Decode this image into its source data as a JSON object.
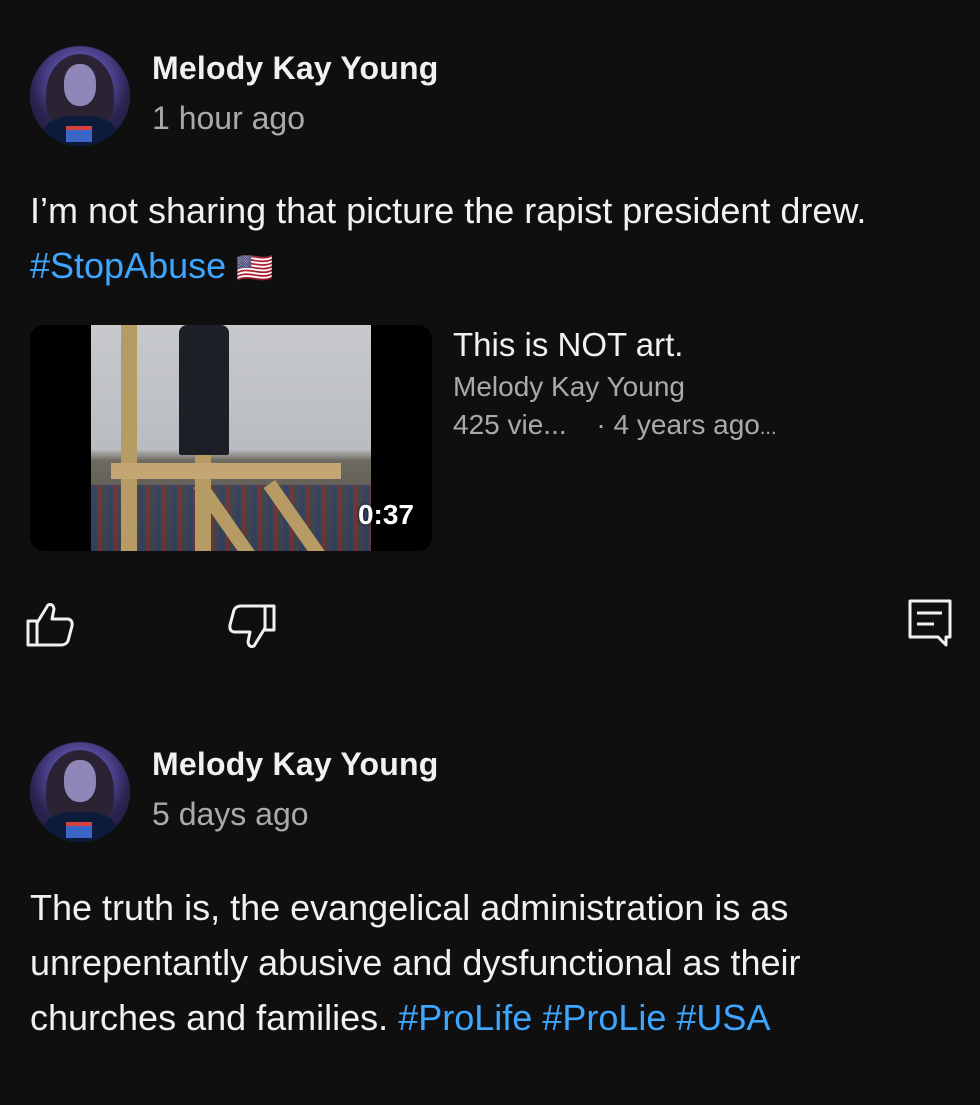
{
  "posts": [
    {
      "author": "Melody Kay Young",
      "time": "1 hour ago",
      "text_plain": "I’m not sharing that picture the rapist president drew. ",
      "hashtags": [
        "#StopAbuse"
      ],
      "emoji": "🇺🇸",
      "video": {
        "title": "This is NOT art.",
        "channel": "Melody Kay Young",
        "views": "425 vie...",
        "age": "· 4 years ago",
        "more": "...",
        "duration": "0:37"
      },
      "actions": {
        "like_icon": "thumbs-up-icon",
        "dislike_icon": "thumbs-down-icon",
        "comment_icon": "comment-icon"
      }
    },
    {
      "author": "Melody Kay Young",
      "time": "5 days ago",
      "text_line1": "The truth is, the evangelical administration is as",
      "text_line2": "unrepentantly abusive and dysfunctional as their",
      "text_line3_plain": "churches and families. ",
      "hashtags": [
        "#ProLife",
        "#ProLie",
        "#USA"
      ]
    }
  ],
  "colors": {
    "background": "#0f0f0f",
    "text": "#f1f1f1",
    "secondary": "#aaaaaa",
    "hashtag": "#3ea6ff"
  }
}
